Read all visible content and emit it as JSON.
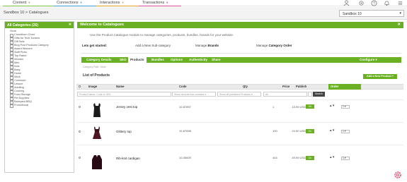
{
  "topnav": {
    "items": [
      {
        "label": "Content",
        "color": "#7cc242"
      },
      {
        "label": "Connections",
        "color": "#3d9bd7"
      },
      {
        "label": "Interactions",
        "color": "#e0a020"
      },
      {
        "label": "Transactions",
        "color": "#d04aa0"
      }
    ],
    "icons": [
      "user-icon",
      "gear-icon",
      "help-icon",
      "bell-icon",
      "menu-icon"
    ]
  },
  "subheader": {
    "breadcrumb": "Sandbox 10 > Catalogues",
    "site_select": "Sandbox 10"
  },
  "sidebar": {
    "title": "All Categories (26)",
    "root": "Store",
    "items": [
      "Crossthorn Chart",
      "Gifts for Tech Junkies",
      "Gift Sets",
      "Blog Post Products Category",
      "Award Winners",
      "Staff Picks",
      "Top Rated",
      "Women",
      "Men",
      "Kids",
      "Baby",
      "Home",
      "Work",
      "Commute",
      "Leisure",
      "Adulting",
      "Cooking",
      "Food Storage",
      "Pet Supplies",
      "Backyard BBQ",
      "Promotional"
    ]
  },
  "welcome": {
    "title": "Welcome to Catalogues",
    "description": "Use the Product Catalogue module to manage categories, products, bundles, brands for your website.",
    "get_started_label": "Lets get started:",
    "links": [
      {
        "prefix": "Add a New Sub-category",
        "bold": ""
      },
      {
        "prefix": "Manage ",
        "bold": "Brands"
      },
      {
        "prefix": "Manage ",
        "bold": "Category Order"
      }
    ]
  },
  "tabs": {
    "items": [
      "Category Details",
      "SEO",
      "Products",
      "Bundles",
      "Options",
      "Authenticity",
      "Share"
    ],
    "active": "Products",
    "configure": "Configure"
  },
  "products": {
    "breadcrumb": "Category Path: Store",
    "title": "List of Products",
    "add_button": "Add a New Product",
    "columns": [
      "Image",
      "Name",
      "Code",
      "Qty",
      "Price",
      "Publish",
      "Order"
    ],
    "filters": {
      "search_placeholder": "Product Name, Code or URL",
      "records": "Show records that contains",
      "published": "Show all published Products",
      "all": "All",
      "search_button": "Search"
    },
    "rows": [
      {
        "name": "Jersey vest top",
        "code": "10-87897",
        "qty": "1",
        "price": "15.99 USD",
        "publish": "On",
        "order": "1"
      },
      {
        "name": "Glittery top",
        "code": "10-87658",
        "qty": "100",
        "price": "24.50 USD",
        "publish": "On",
        "order": "1"
      },
      {
        "name": "Rib-knit cardigan",
        "code": "10-45609",
        "qty": "444",
        "price": "49.99 USD",
        "publish": "On",
        "order": "1"
      }
    ]
  }
}
